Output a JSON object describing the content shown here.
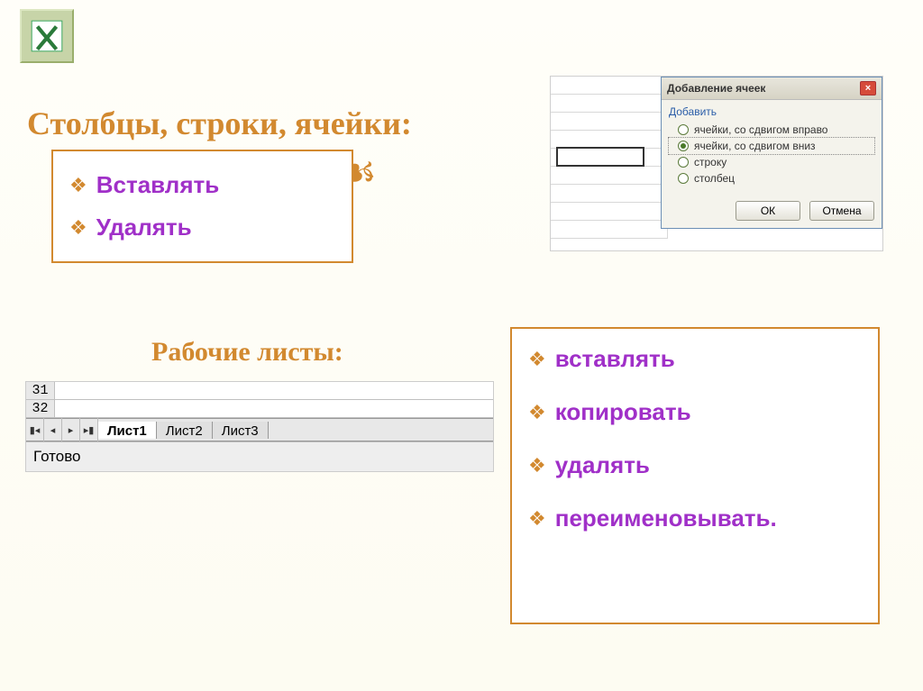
{
  "heading1": "Столбцы, строки, ячейки:",
  "heading2": "Рабочие листы:",
  "box1": {
    "items": [
      "Вставлять",
      "Удалять"
    ]
  },
  "box2": {
    "items": [
      "вставлять",
      "копировать",
      "удалять",
      "переименовывать."
    ]
  },
  "sheets": {
    "row31": "31",
    "row32": "32",
    "tabs": [
      "Лист1",
      "Лист2",
      "Лист3"
    ],
    "status": "Готово"
  },
  "dialog": {
    "title": "Добавление ячеек",
    "group": "Добавить",
    "options": [
      "ячейки, со сдвигом вправо",
      "ячейки, со сдвигом вниз",
      "строку",
      "столбец"
    ],
    "selected_index": 1,
    "ok": "ОК",
    "cancel": "Отмена"
  }
}
